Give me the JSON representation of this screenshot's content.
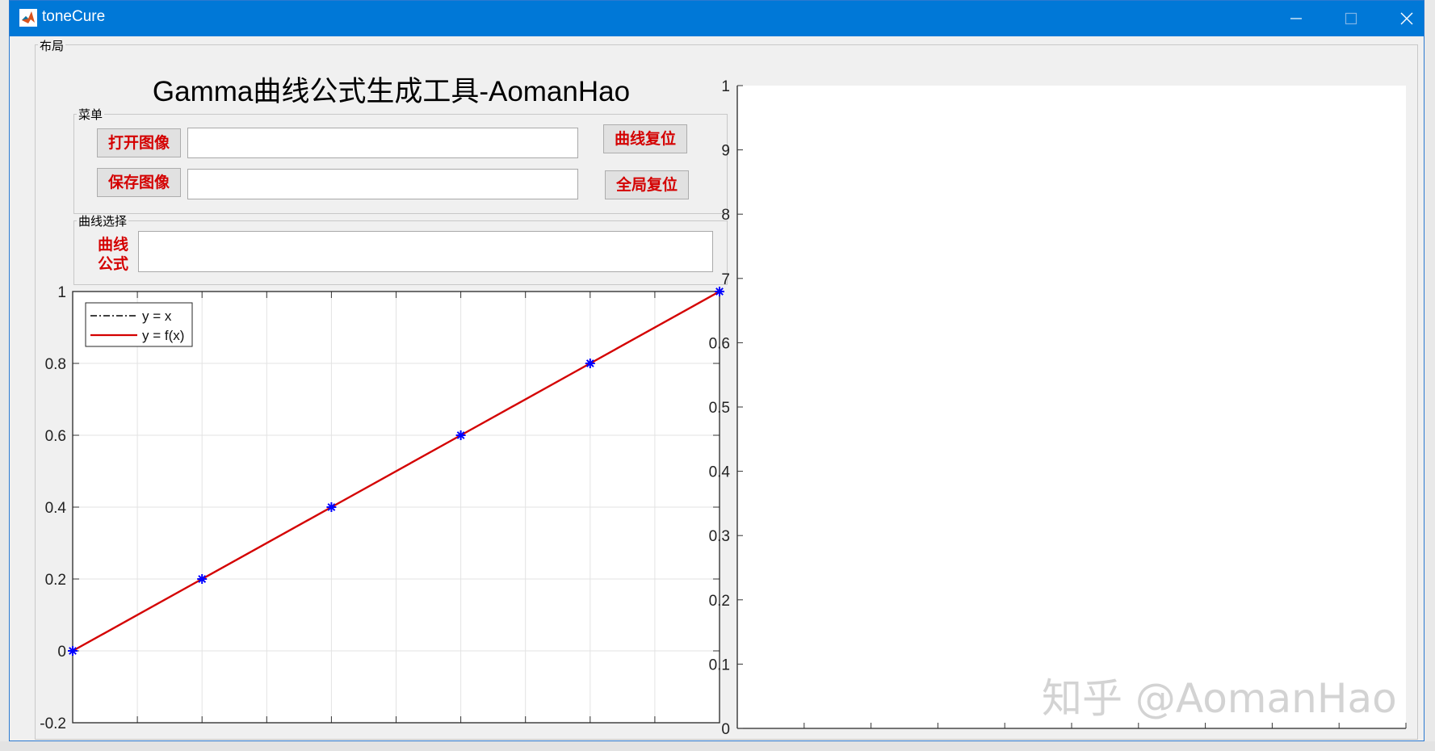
{
  "window": {
    "title": "toneCure"
  },
  "layout_group": {
    "label": "布局"
  },
  "app_title": "Gamma曲线公式生成工具-AomanHao",
  "menu_group": {
    "label": "菜单",
    "open_image": "打开图像",
    "save_image": "保存图像",
    "curve_reset": "曲线复位",
    "global_reset": "全局复位",
    "open_path_value": "",
    "save_path_value": ""
  },
  "curve_group": {
    "label": "曲线选择",
    "formula_label_line1": "曲线",
    "formula_label_line2": "公式",
    "formula_value": ""
  },
  "watermark": "知乎 @AomanHao",
  "chart_data": [
    {
      "type": "line",
      "xlim": [
        0,
        1
      ],
      "ylim": [
        -0.2,
        1
      ],
      "yticks": [
        "1",
        "0.8",
        "0.6",
        "0.4",
        "0.2",
        "0",
        "-0.2"
      ],
      "grid": true,
      "legend_position": "top-left",
      "series": [
        {
          "name": "y = x",
          "style": "dash-dot",
          "color": "#000000",
          "x": [
            0,
            0.2,
            0.4,
            0.6,
            0.8,
            1
          ],
          "y": [
            0,
            0.2,
            0.4,
            0.6,
            0.8,
            1
          ]
        },
        {
          "name": "y = f(x)",
          "style": "solid",
          "color": "#d40000",
          "marker_color": "#0000ff",
          "x": [
            0,
            0.2,
            0.4,
            0.6,
            0.8,
            1
          ],
          "y": [
            0,
            0.2,
            0.4,
            0.6,
            0.8,
            1
          ]
        }
      ]
    },
    {
      "type": "line",
      "ylim": [
        0,
        1
      ],
      "yticks": [
        "1",
        "9",
        "8",
        "7",
        "0.6",
        "0.5",
        "0.4",
        "0.3",
        "0.2",
        "0.1",
        "0"
      ],
      "grid": false,
      "series": []
    }
  ],
  "colors": {
    "titlebar": "#0078d7",
    "button_text": "#d40000",
    "curve": "#d40000",
    "marker": "#0000ff"
  }
}
